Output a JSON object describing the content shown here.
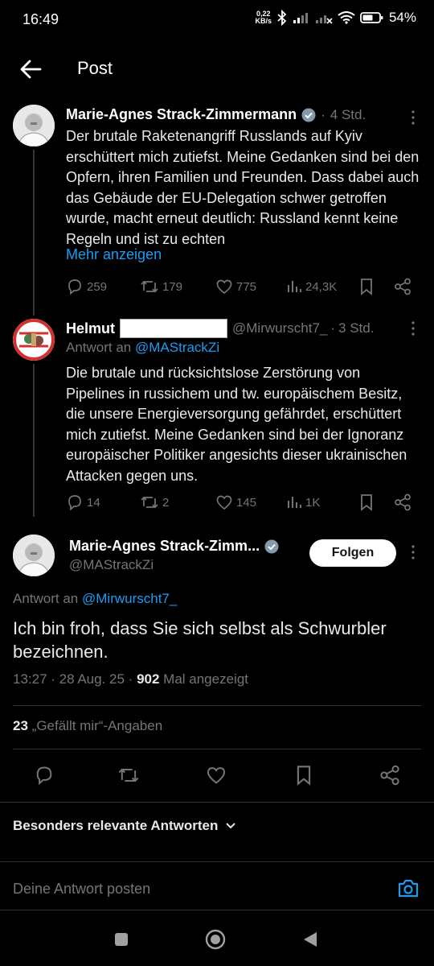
{
  "status": {
    "time": "16:49",
    "net_speed_value": "0,22",
    "net_speed_unit": "KB/s",
    "battery": "54%"
  },
  "header": {
    "title": "Post"
  },
  "tweet1": {
    "author": "Marie-Agnes Strack-Zimmermann",
    "dot": "·",
    "time": "4 Std.",
    "text": "Der brutale Raketenangriff Russlands auf Kyiv erschüttert mich zutiefst. Meine Gedanken sind bei den Opfern, ihren Familien und Freunden. Dass dabei auch das Gebäude der EU-Delegation schwer getroffen wurde, macht erneut deutlich: Russland kennt keine Regeln und ist zu echten",
    "show_more": "Mehr anzeigen",
    "replies": "259",
    "reposts": "179",
    "likes": "775",
    "views": "24,3K"
  },
  "tweet2": {
    "author": "Helmut",
    "handle": "@Mirwurscht7_",
    "dot": "·",
    "time": "3 Std.",
    "reply_prefix": "Antwort an",
    "reply_to": "@MAStrackZi",
    "text": "Die brutale und rücksichtslose Zerstörung von Pipelines in russichem und tw. europäischem Besitz, die unsere Energieversorgung gefährdet, erschüttert mich zutiefst. Meine Gedanken sind bei der Ignoranz europäischer Politiker angesichts dieser ukrainischen Attacken gegen uns.",
    "replies": "14",
    "reposts": "2",
    "likes": "145",
    "views": "1K"
  },
  "main": {
    "author": "Marie-Agnes Strack-Zimm...",
    "handle": "@MAStrackZi",
    "follow_label": "Folgen",
    "reply_prefix": "Antwort an",
    "reply_to": "@Mirwurscht7_",
    "text": "Ich bin froh, dass Sie sich selbst als Schwurbler bezeichnen.",
    "timestamp": "13:27 · 28 Aug. 25 · ",
    "views_count": "902",
    "views_label": " Mal angezeigt",
    "likes_count": "23",
    "likes_label": "„Gefällt mir“-Angaben"
  },
  "replies_sort": {
    "label": "Besonders relevante Antworten"
  },
  "reply_box": {
    "placeholder": "Deine Antwort posten"
  },
  "colors": {
    "accent": "#1d9bf0",
    "background": "#000000",
    "text": "#e7e9ea",
    "muted": "#71767b"
  },
  "icons": [
    "back-arrow-icon",
    "verified-icon",
    "more-icon",
    "reply-icon",
    "repost-icon",
    "like-icon",
    "views-icon",
    "bookmark-icon",
    "share-icon",
    "camera-icon",
    "chevron-down-icon"
  ]
}
